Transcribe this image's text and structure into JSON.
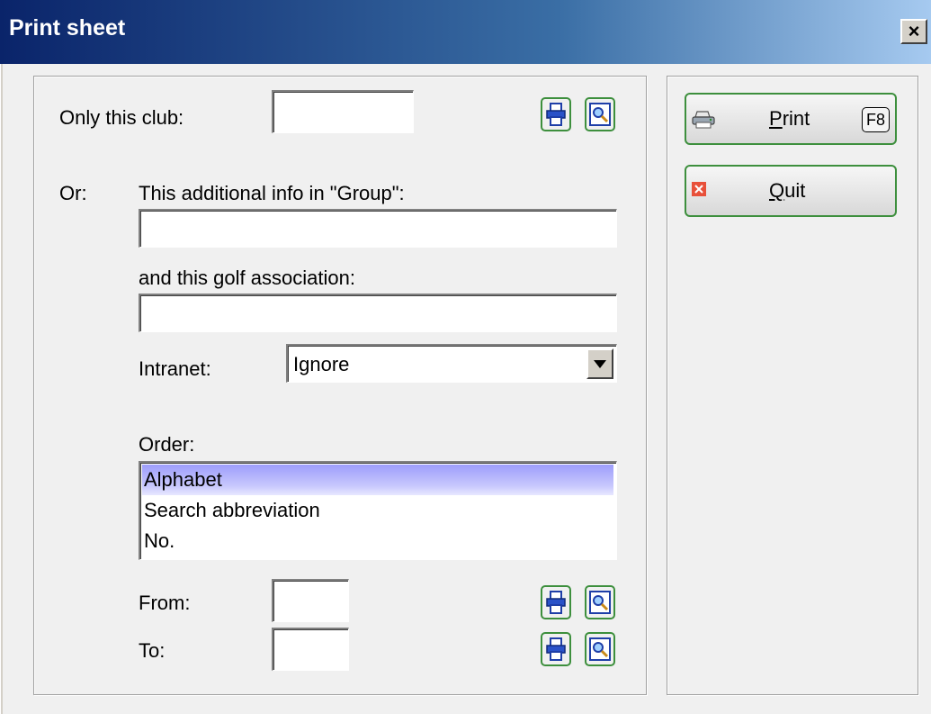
{
  "window": {
    "title": "Print sheet",
    "close_label": "×"
  },
  "left_panel": {
    "only_club_label": "Only this club:",
    "only_club_value": "",
    "or_label": "Or:",
    "group_info_label": "This additional info in \"Group\":",
    "group_info_value": "",
    "association_label": "and this golf association:",
    "association_value": "",
    "intranet_label": "Intranet:",
    "intranet_value": "Ignore",
    "order_label": "Order:",
    "order_options": [
      "Alphabet",
      "Search abbreviation",
      "No."
    ],
    "order_selected": "Alphabet",
    "from_label": "From:",
    "from_value": "",
    "to_label": "To:",
    "to_value": ""
  },
  "right_panel": {
    "print_button": {
      "mnemonic": "P",
      "rest": "rint",
      "shortcut": "F8"
    },
    "quit_button": {
      "mnemonic": "Q",
      "rest": "uit"
    }
  },
  "icons": {
    "printer_small": "printer-icon",
    "magnifier": "magnifier-icon",
    "print_button_icon": "printer-icon",
    "quit_button_icon": "close-x-icon",
    "dropdown_arrow": "chevron-down-icon"
  },
  "colors": {
    "titlebar_start": "#0a246a",
    "titlebar_end": "#a6caf0",
    "button_border": "#3d8f3d",
    "selection": "#9d9dfb"
  }
}
